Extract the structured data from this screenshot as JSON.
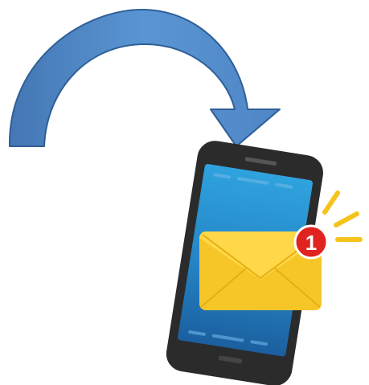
{
  "notification": {
    "count": "1"
  },
  "icons": {
    "arrow": "curved-arrow-icon",
    "phone": "smartphone-icon",
    "envelope": "envelope-icon",
    "badge": "notification-badge",
    "alert_rays": "alert-rays-icon"
  },
  "colors": {
    "arrow_fill": "#4f86c6",
    "arrow_stroke": "#2f5f97",
    "phone_body": "#2b2b2b",
    "screen_top": "#2fa0dc",
    "screen_bottom": "#1f67a8",
    "envelope_front": "#f6c629",
    "envelope_flap": "#ffd84a",
    "badge_fill": "#e0231f",
    "badge_text": "#ffffff",
    "rays": "#f5c31b"
  }
}
